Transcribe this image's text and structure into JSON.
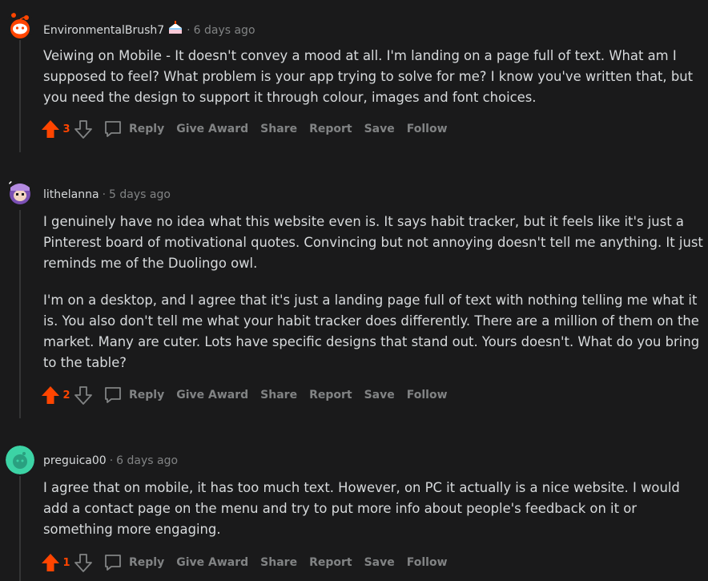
{
  "comments": [
    {
      "author": "EnvironmentalBrush7",
      "separator": "·",
      "time": "6 days ago",
      "flair_icon": "cake-icon",
      "paragraphs": [
        "Veiwing on Mobile - It doesn't convey a mood at all. I'm landing on a page full of text. What am I supposed to feel? What problem is your app trying to solve for me? I know you've written that, but you need the design to support it through colour, images and font choices."
      ],
      "score": "3"
    },
    {
      "author": "lithelanna",
      "separator": "·",
      "time": "5 days ago",
      "paragraphs": [
        "I genuinely have no idea what this website even is. It says habit tracker, but it feels like it's just a Pinterest board of motivational quotes. Convincing but not annoying doesn't tell me anything. It just reminds me of the Duolingo owl.",
        "I'm on a desktop, and I agree that it's just a landing page full of text with nothing telling me what it is. You also don't tell me what your habit tracker does differently. There are a million of them on the market. Many are cuter. Lots have specific designs that stand out. Yours doesn't. What do you bring to the table?"
      ],
      "score": "2"
    },
    {
      "author": "preguica00",
      "separator": "·",
      "time": "6 days ago",
      "paragraphs": [
        "I agree that on mobile, it has too much text. However, on PC it actually is a nice website. I would add a contact page on the menu and try to put more info about people's feedback on it or something more engaging."
      ],
      "score": "1"
    }
  ],
  "actions": {
    "reply": "Reply",
    "give_award": "Give Award",
    "share": "Share",
    "report": "Report",
    "save": "Save",
    "follow": "Follow"
  },
  "icons": {
    "upvote": "upvote-arrow-icon",
    "downvote": "downvote-arrow-icon",
    "reply": "speech-bubble-icon"
  },
  "colors": {
    "background": "#1a1a1b",
    "text": "#d7dadc",
    "muted": "#818384",
    "upvote": "#ff4500"
  }
}
